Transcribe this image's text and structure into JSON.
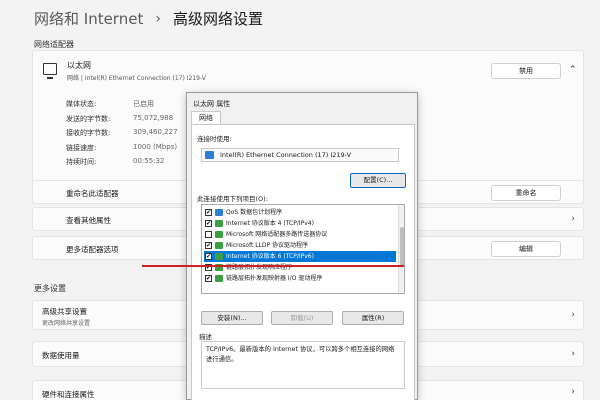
{
  "breadcrumb": {
    "parent": "网络和 Internet",
    "separator": "›",
    "current": "高级网络设置"
  },
  "network_adapters": {
    "section_label": "网络适配器",
    "adapter": {
      "name": "以太网",
      "description": "网络 | Intel(R) Ethernet Connection (17) I219-V",
      "disable_label": "禁用",
      "details": [
        {
          "key": "媒体状态:",
          "value": "已启用"
        },
        {
          "key": "发送的字节数:",
          "value": "75,072,988"
        },
        {
          "key": "接收的字节数:",
          "value": "309,460,227"
        },
        {
          "key": "链接速度:",
          "value": "1000 (Mbps)"
        },
        {
          "key": "持续时间:",
          "value": "00:55:32"
        }
      ]
    },
    "rows": [
      {
        "label": "重命名此适配器",
        "button": "重命名"
      },
      {
        "label": "查看其他属性"
      },
      {
        "label": "更多适配器选项",
        "button": "编辑"
      }
    ]
  },
  "more_settings": {
    "section_label": "更多设置",
    "rows": [
      {
        "label": "高级共享设置",
        "sub": "更改网络共享设置"
      },
      {
        "label": "数据使用量"
      },
      {
        "label": "硬件和连接属性"
      }
    ]
  },
  "dialog": {
    "title": "以太网 属性",
    "tab": "网络",
    "connect_label": "连接时使用:",
    "nic_name": "Intel(R) Ethernet Connection (17) I219-V",
    "configure_label": "配置(C)...",
    "items_label": "此连接使用下列项目(O):",
    "items": [
      {
        "text": "QoS 数据包计划程序",
        "checked": true,
        "icon_color": "#2d7fd2",
        "selected": false
      },
      {
        "text": "Internet 协议版本 4 (TCP/IPv4)",
        "checked": true,
        "icon_color": "#3aa043",
        "selected": false
      },
      {
        "text": "Microsoft 网络适配器多路传送器协议",
        "checked": false,
        "icon_color": "#3aa043",
        "selected": false
      },
      {
        "text": "Microsoft LLDP 协议驱动程序",
        "checked": true,
        "icon_color": "#3aa043",
        "selected": false
      },
      {
        "text": "Internet 协议版本 6 (TCP/IPv6)",
        "checked": true,
        "icon_color": "#3aa043",
        "selected": true
      },
      {
        "text": "链路层拓扑发现响应程序",
        "checked": true,
        "icon_color": "#3aa043",
        "selected": false
      },
      {
        "text": "链路层拓扑发现映射器 I/O 驱动程序",
        "checked": true,
        "icon_color": "#3aa043",
        "selected": false
      }
    ],
    "install_label": "安装(N)...",
    "uninstall_label": "卸载(U)",
    "properties_label": "属性(R)",
    "description_label": "描述",
    "description_text": "TCP/IPv6。最新版本的 Internet 协议，可以跨多个相互连接的网络进行通信。"
  },
  "colors": {
    "accent": "#0078d7",
    "annotation_line": "#cc2222"
  },
  "icons": [
    "monitor-icon",
    "chevron-up-icon",
    "chevron-right-icon",
    "network-adapter-icon"
  ]
}
